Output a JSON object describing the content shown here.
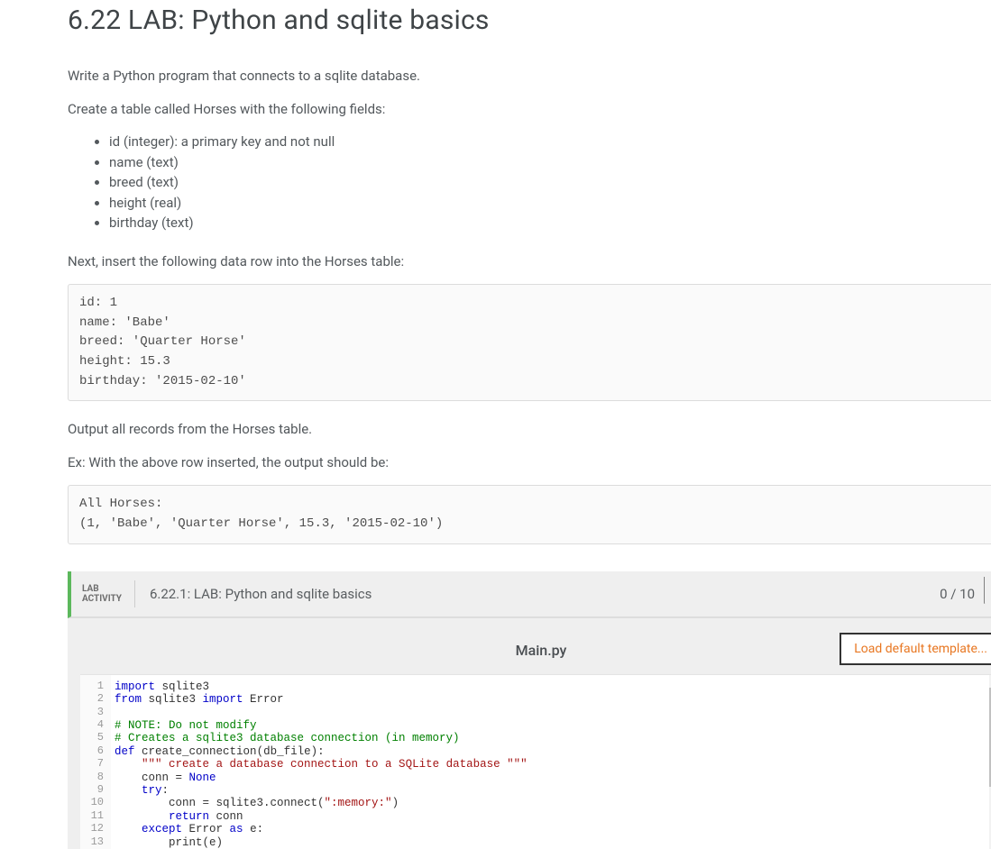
{
  "title": "6.22 LAB: Python and sqlite basics",
  "intro": "Write a Python program that connects to a sqlite database.",
  "create_table_text": "Create a table called Horses with the following fields:",
  "fields": [
    "id (integer): a primary key and not null",
    "name (text)",
    "breed (text)",
    "height (real)",
    "birthday (text)"
  ],
  "insert_text": "Next, insert the following data row into the Horses table:",
  "insert_block": "id: 1\nname: 'Babe'\nbreed: 'Quarter Horse'\nheight: 15.3\nbirthday: '2015-02-10'",
  "output_text": "Output all records from the Horses table.",
  "ex_text": "Ex: With the above row inserted, the output should be:",
  "output_block": "All Horses:\n(1, 'Babe', 'Quarter Horse', 15.3, '2015-02-10')",
  "lab_bar": {
    "label": "LAB\nACTIVITY",
    "name": "6.22.1: LAB: Python and sqlite basics",
    "score": "0 / 10"
  },
  "editor": {
    "filename": "Main.py",
    "load_template": "Load default template..."
  },
  "code": [
    {
      "n": 1,
      "tokens": [
        [
          "kw",
          "import"
        ],
        [
          "",
          " sqlite3"
        ]
      ]
    },
    {
      "n": 2,
      "tokens": [
        [
          "kw",
          "from"
        ],
        [
          "",
          " sqlite3 "
        ],
        [
          "kw",
          "import"
        ],
        [
          "",
          " Error"
        ]
      ]
    },
    {
      "n": 3,
      "tokens": [
        [
          "",
          ""
        ]
      ]
    },
    {
      "n": 4,
      "tokens": [
        [
          "cm",
          "# NOTE: Do not modify"
        ]
      ]
    },
    {
      "n": 5,
      "tokens": [
        [
          "cm",
          "# Creates a sqlite3 database connection (in memory)"
        ]
      ]
    },
    {
      "n": 6,
      "tokens": [
        [
          "kw",
          "def"
        ],
        [
          "",
          " "
        ],
        [
          "fn",
          "create_connection"
        ],
        [
          "",
          "(db_file):"
        ]
      ]
    },
    {
      "n": 7,
      "tokens": [
        [
          "",
          "    "
        ],
        [
          "str",
          "\"\"\" create a database connection to a SQLite database \"\"\""
        ]
      ]
    },
    {
      "n": 8,
      "tokens": [
        [
          "",
          "    conn = "
        ],
        [
          "const",
          "None"
        ]
      ]
    },
    {
      "n": 9,
      "tokens": [
        [
          "",
          "    "
        ],
        [
          "kw",
          "try"
        ],
        [
          "",
          ":"
        ]
      ]
    },
    {
      "n": 10,
      "tokens": [
        [
          "",
          "        conn = sqlite3.connect("
        ],
        [
          "str",
          "\":memory:\""
        ],
        [
          "",
          ")"
        ]
      ]
    },
    {
      "n": 11,
      "tokens": [
        [
          "",
          "        "
        ],
        [
          "kw",
          "return"
        ],
        [
          "",
          " conn"
        ]
      ]
    },
    {
      "n": 12,
      "tokens": [
        [
          "",
          "    "
        ],
        [
          "kw",
          "except"
        ],
        [
          "",
          " Error "
        ],
        [
          "kw",
          "as"
        ],
        [
          "",
          " e:"
        ]
      ]
    },
    {
      "n": 13,
      "tokens": [
        [
          "",
          "        print(e)"
        ]
      ]
    }
  ]
}
